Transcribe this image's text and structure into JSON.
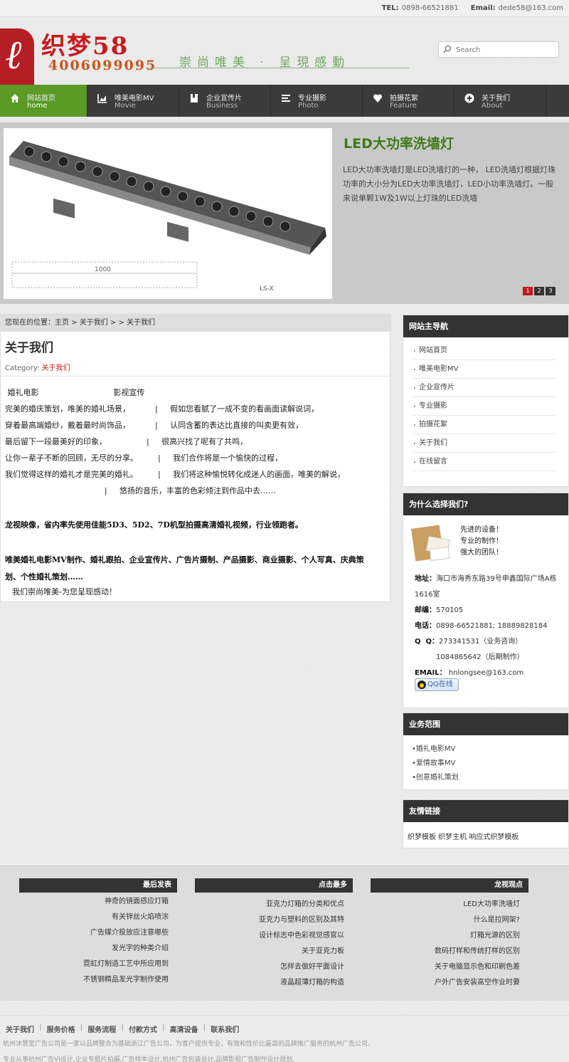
{
  "topbar": {
    "tel_label": "TEL:",
    "tel": "0898-66521881",
    "email_label": "Email:",
    "email": "dede58@163.com"
  },
  "header": {
    "logo_name": "织梦58",
    "logo_phone": "4006099095",
    "slogan": "崇尚唯美 · 呈現感動"
  },
  "search": {
    "placeholder": "Search"
  },
  "nav": {
    "items": [
      {
        "cn": "网站首页",
        "en": "home"
      },
      {
        "cn": "唯美电影MV",
        "en": "Movie"
      },
      {
        "cn": "企业宣传片",
        "en": "Business"
      },
      {
        "cn": "专业摄影",
        "en": "Photo"
      },
      {
        "cn": "拍摄花絮",
        "en": "Feature"
      },
      {
        "cn": "关于我们",
        "en": "About"
      }
    ]
  },
  "banner": {
    "title": "LED大功率洗墙灯",
    "desc": "LED大功率洗墙灯是LED洗墙灯的一种， LED洗墙灯根据灯珠功率的大小分为LED大功率洗墙灯，LED小功率洗墙灯。一般来说单颗1W及1W以上灯珠的LED洗墙",
    "img_dim_label": "1000",
    "img_brand": "LS-X",
    "pages": [
      "1",
      "2",
      "3"
    ]
  },
  "breadcrumb": {
    "text": "您现在的位置：主页 > 关于我们 > > 关于我们"
  },
  "article": {
    "title": "关于我们",
    "category_label": "Category:",
    "category": "关于我们",
    "lines": [
      " 婚礼电影                              影视宣传",
      "完美的婚庆策划，唯美的婚礼场景，          |     假如您看腻了一成不变的看画面读解说词，",
      "穿着最高端婚纱，戴着最时尚饰品，          |     认同含蓄的表达比直接的叫卖更有效，",
      "最后留下一段最美好的印象，                |     很高兴找了呢有了共鸣，",
      "让你一辈子不断的回顾，无尽的分享。        |     我们合作将是一个愉快的过程，",
      "我们觉得这样的婚礼才是完美的婚礼。        |     我们将这种愉悦转化成迷人的画面，唯美的解说，",
      "                                        |     悠扬的音乐，丰富的色彩倾注到作品中去……"
    ],
    "bold1": "龙视映像，省内率先使用佳能5D3、5D2、7D机型拍摄高清婚礼视频，行业领跑者。",
    "bold2": "唯美婚礼电影MV制作、婚礼跟拍、企业宣传片、广告片摄制、产品摄影、商业摄影、个人写真、庆典策划、个性婚礼策划……",
    "closing": "我们崇尚唯美-为您呈现感动！"
  },
  "sidebar": {
    "nav_title": "网站主导航",
    "nav_items": [
      "网站首页",
      "唯美电影MV",
      "企业宣传片",
      "专业摄影",
      "拍摄花絮",
      "关于我们",
      "在线留言"
    ],
    "why_title": "为什么选择我们?",
    "why_list": [
      "先进的设备！",
      "专业的制作！",
      "强大的团队！"
    ],
    "address_label": "地址：",
    "address": "海口市海秀东路39号申鑫国际广场A栋1616室",
    "zip_label": "邮编：",
    "zip": "570105",
    "phone_label": "电话：",
    "phone": "0898-66521881; 18889828184",
    "qq_label": "Q  Q：",
    "qq1": "273341531（业务咨询）",
    "qq2": "1084865642（后期制作）",
    "email_label": "EMAIL：",
    "email": "hnlongsee@163.com",
    "qq_button": "QQ在线",
    "svc_title": "业务范围",
    "svc_items": [
      "•婚礼电影MV",
      "•爱情故事MV",
      "•创意婚礼策划"
    ],
    "link_title": "友情链接",
    "links": "织梦模板 织梦主机 响应式织梦模板"
  },
  "footer": {
    "col1_title": "最后发表",
    "col1_items": [
      "神奇的镜面感应灯箱",
      "有关锌丝火焰喷涂",
      "广告媒介投放应注意哪些",
      "发光字的种类介绍",
      "霓虹灯制造工艺中所应用到",
      "不锈钢精品发光字制作使用"
    ],
    "col2_title": "点击最多",
    "col2_items": [
      "亚克力灯箱的分类和优点",
      "亚克力与塑料的区别及其特",
      "设计标志中色彩视觉感官以",
      "关于亚克力板",
      "怎样去做好平面设计",
      "液晶超薄灯箱的构造"
    ],
    "col3_title": "龙视观点",
    "col3_items": [
      "LED大功率洗墙灯",
      "什么是拉网架?",
      "灯箱光源的区别",
      "数码打样和传统打样的区别",
      "关于电脑显示色和印刷色差",
      "户外广告安装高空作业时要"
    ],
    "bottom_links": [
      "关于我们",
      "服务价格",
      "服务流程",
      "付款方式",
      "高清设备",
      "联系我们"
    ],
    "copy1": "杭州沐慧堂广告公司是一家以品牌整合为基础浙江广告公司，为客户提供专业、有效和性价比最高的品牌推广服务的杭州广告公司，",
    "copy2": "专业从事杭州广告VI设计,企业专题片拍摄,广告样本设计,杭州广告包装设计,品牌影视广告制作设计规划."
  },
  "colors": {
    "nav_active": "#5a9a25",
    "nav_bg": "#3b3b3b",
    "brand_red": "#c61a1e",
    "banner_title": "#3d7a18"
  }
}
